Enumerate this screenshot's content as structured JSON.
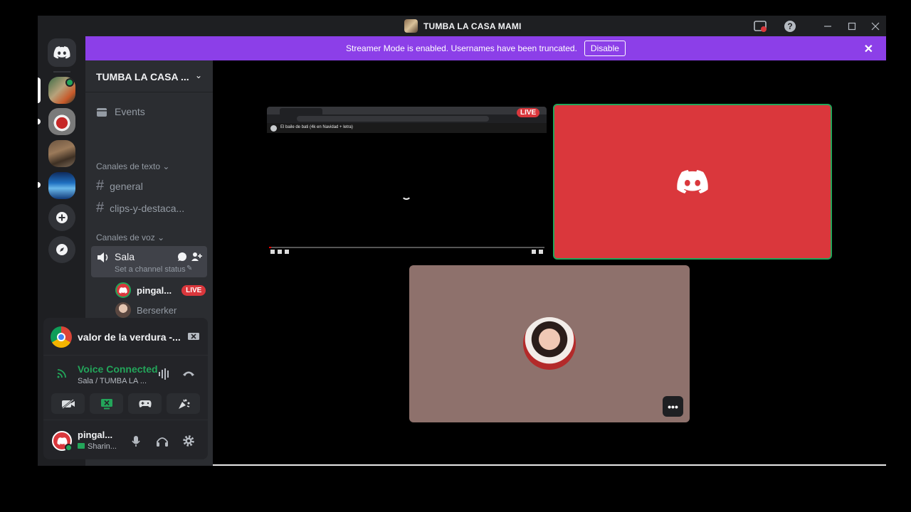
{
  "window": {
    "title": "TUMBA LA CASA MAMI"
  },
  "banner": {
    "text": "Streamer Mode is enabled. Usernames have been truncated.",
    "button": "Disable"
  },
  "sidebar": {
    "guild_name": "TUMBA LA CASA ...",
    "events_label": "Events",
    "text_category": "Canales de texto",
    "text_channels": [
      "general",
      "clips-y-destaca..."
    ],
    "voice_category": "Canales de voz",
    "voice_channel": {
      "name": "Sala",
      "status": "Set a channel status"
    },
    "voice_users": [
      {
        "name": "pingal...",
        "live": "LIVE"
      },
      {
        "name": "Berserker"
      }
    ]
  },
  "panel": {
    "activity": "valor de la verdura -...",
    "voice_status": "Voice Connected",
    "voice_location": "Sala / TUMBA LA ...",
    "username": "pingal...",
    "user_status": "Sharin..."
  },
  "stage": {
    "stream_live_badge": "LIVE",
    "stream_video_title": "El baile de bati (4k en Navidad + letra)"
  },
  "colors": {
    "accent": "#5865f2",
    "banner": "#8c3fe8",
    "tile_red": "#da373c",
    "tile_mauve": "#8e716c",
    "speaking": "#23a55a",
    "live": "#da373c"
  }
}
